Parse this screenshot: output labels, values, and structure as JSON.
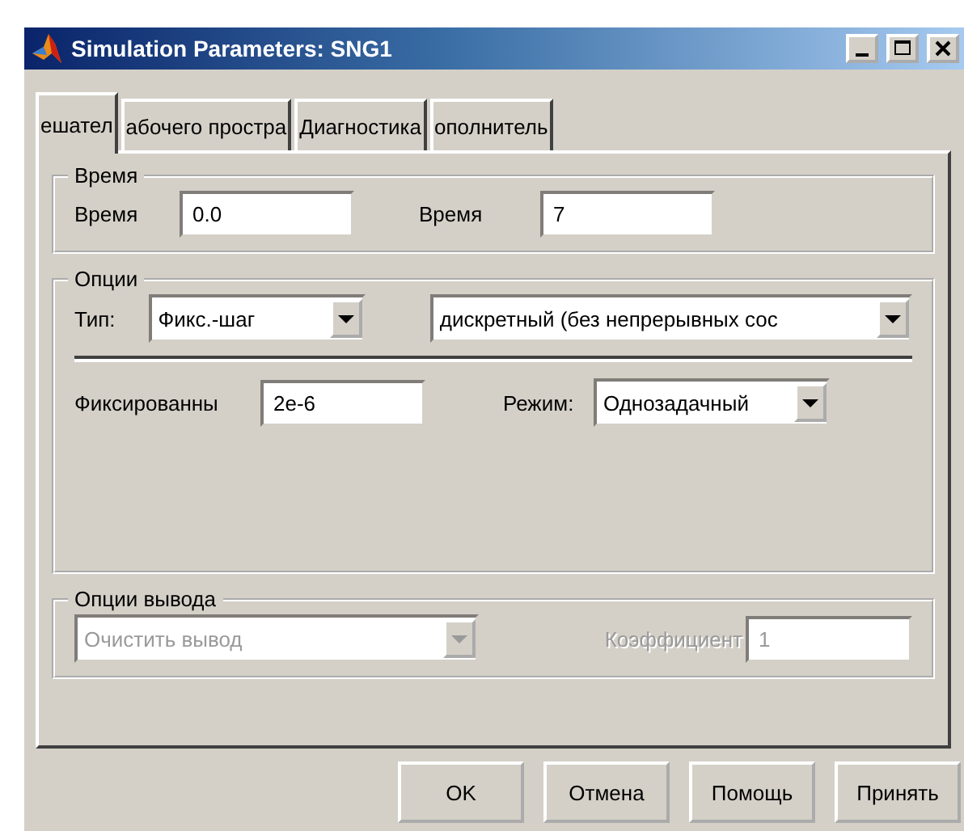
{
  "window": {
    "title": "Simulation Parameters: SNG1"
  },
  "tabs": [
    {
      "label": "ешател",
      "selected": true
    },
    {
      "label": "абочего простра",
      "selected": false
    },
    {
      "label": "Диагностика",
      "selected": false
    },
    {
      "label": "ополнитель",
      "selected": false
    }
  ],
  "time_group": {
    "title": "Время",
    "fields": [
      {
        "label": "Время",
        "value": "0.0"
      },
      {
        "label": "Время",
        "value": "7"
      }
    ]
  },
  "options_group": {
    "title": "Опции",
    "type_label": "Тип:",
    "type_value": "Фикс.-шаг",
    "solver_value": "дискретный (без непрерывных сос",
    "step_label": "Фиксированны",
    "step_value": "2e-6",
    "mode_label": "Режим:",
    "mode_value": "Однозадачный"
  },
  "output_group": {
    "title": "Опции вывода",
    "output_value": "Очистить вывод",
    "output_disabled": true,
    "factor_label": "Коэффициент",
    "factor_value": "1",
    "factor_disabled": true
  },
  "buttons": [
    "OK",
    "Отмена",
    "Помощь",
    "Принять"
  ]
}
